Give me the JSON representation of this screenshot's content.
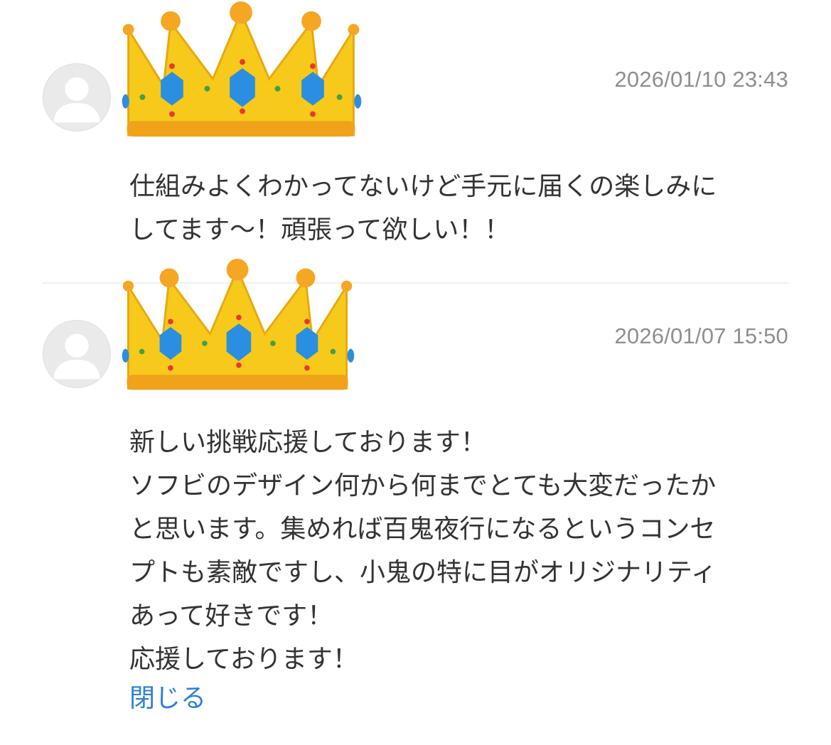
{
  "comments": [
    {
      "timestamp": "2026/01/10 23:43",
      "text": "仕組みよくわかってないけど手元に届くの楽しみに\nしてます〜！頑張って欲しい！！",
      "avatar_icon": "default-user-avatar-icon",
      "badge_icon": "crown-icon"
    },
    {
      "timestamp": "2026/01/07 15:50",
      "text": "新しい挑戦応援しております！\nソフビのデザイン何から何までとても大変だったか\nと思います。集めれば百鬼夜行になるというコンセ\nプトも素敵ですし、小鬼の特に目がオリジナリティ\nあって好きです！\n応援しております！",
      "avatar_icon": "default-user-avatar-icon",
      "badge_icon": "crown-icon"
    }
  ],
  "close_label": "閉じる",
  "colors": {
    "link": "#2f7fd6",
    "timestamp": "#8e8e8e",
    "text": "#333333",
    "crown_gold": "#f7c91a",
    "gem_blue": "#2a8fe0"
  }
}
